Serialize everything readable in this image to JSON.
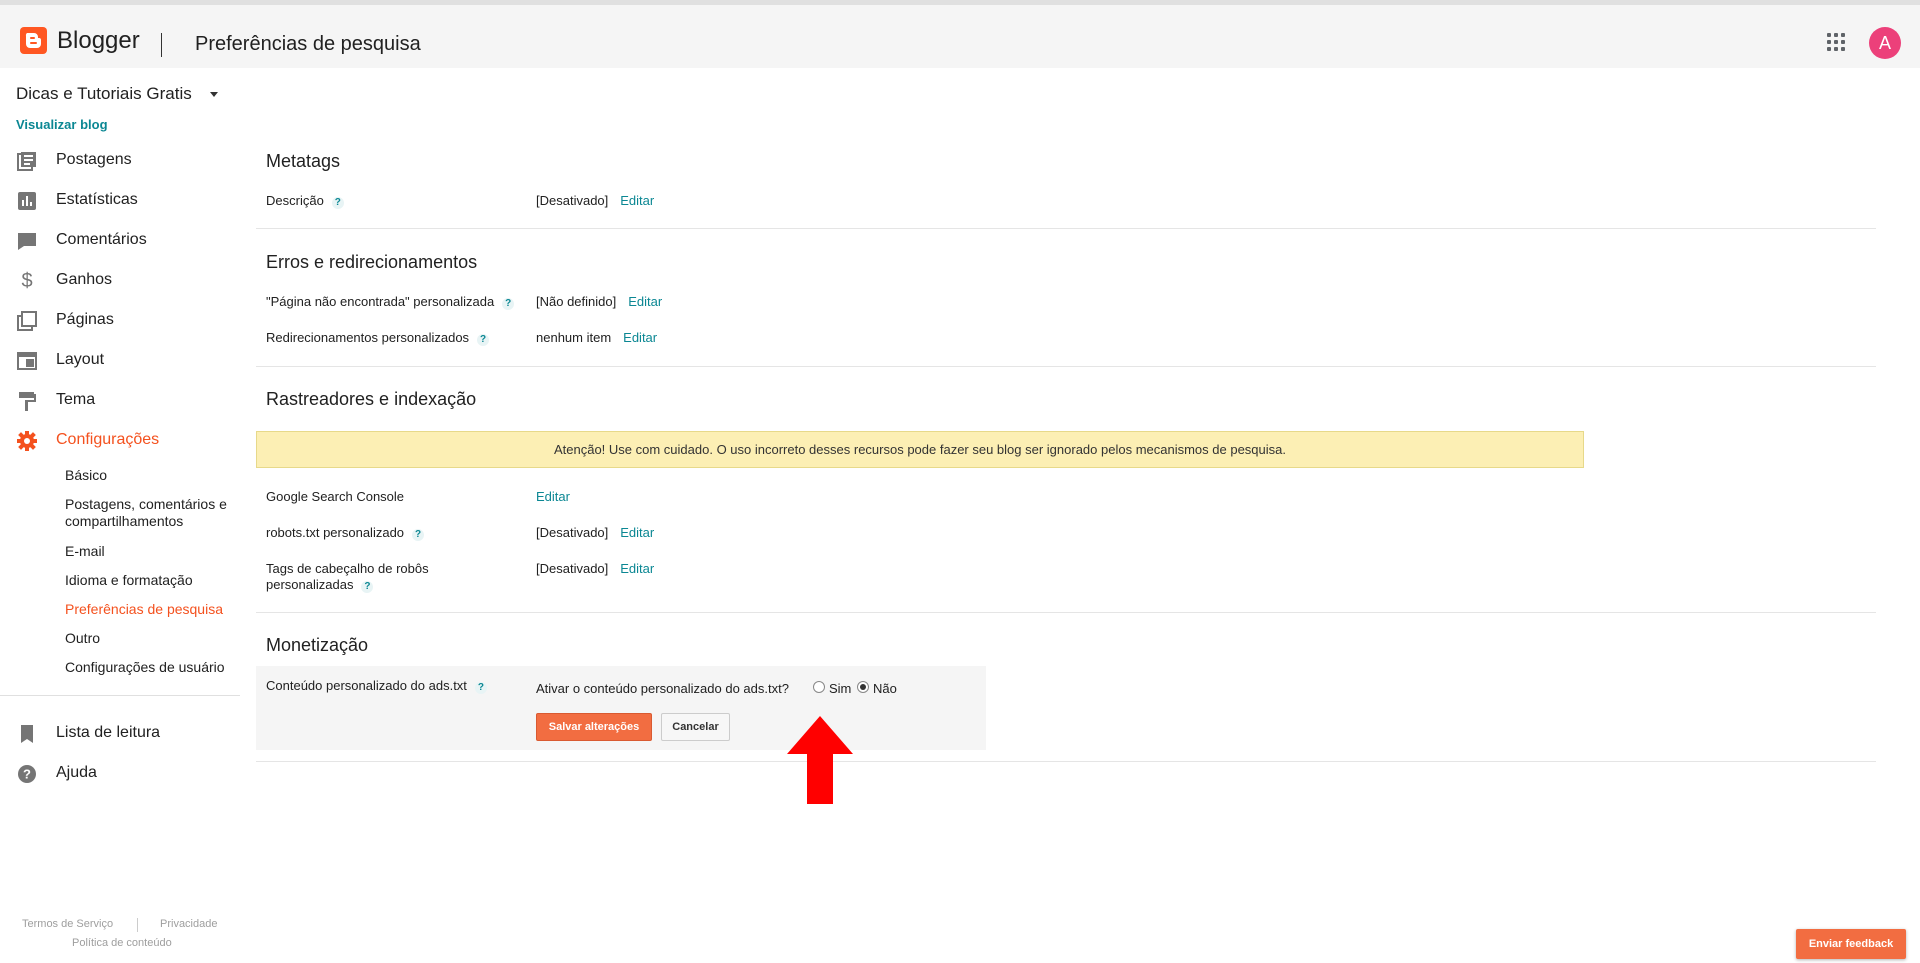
{
  "header": {
    "brand": "Blogger",
    "page_title": "Preferências de pesquisa",
    "avatar_letter": "A"
  },
  "sidebar": {
    "blog_name": "Dicas e Tutoriais Gratis",
    "view_blog": "Visualizar blog",
    "items": [
      {
        "label": "Postagens",
        "icon": "posts-icon"
      },
      {
        "label": "Estatísticas",
        "icon": "stats-icon"
      },
      {
        "label": "Comentários",
        "icon": "comments-icon"
      },
      {
        "label": "Ganhos",
        "icon": "dollar-icon"
      },
      {
        "label": "Páginas",
        "icon": "pages-icon"
      },
      {
        "label": "Layout",
        "icon": "layout-icon"
      },
      {
        "label": "Tema",
        "icon": "theme-icon"
      },
      {
        "label": "Configurações",
        "icon": "gear-icon"
      }
    ],
    "subitems": [
      "Básico",
      "Postagens, comentários e compartilhamentos",
      "E-mail",
      "Idioma e formatação",
      "Preferências de pesquisa",
      "Outro",
      "Configurações de usuário"
    ],
    "reading_list": "Lista de leitura",
    "help": "Ajuda",
    "footer": {
      "terms": "Termos de Serviço",
      "privacy": "Privacidade",
      "content_policy": "Política de conteúdo"
    }
  },
  "main": {
    "metatags": {
      "title": "Metatags",
      "description_label": "Descrição",
      "description_value": "[Desativado]",
      "edit": "Editar"
    },
    "errors": {
      "title": "Erros e redirecionamentos",
      "not_found_label": "\"Página não encontrada\" personalizada",
      "not_found_value": "[Não definido]",
      "redirects_label": "Redirecionamentos personalizados",
      "redirects_value": "nenhum item",
      "edit": "Editar"
    },
    "crawlers": {
      "title": "Rastreadores e indexação",
      "warning": "Atenção! Use com cuidado. O uso incorreto desses recursos pode fazer seu blog ser ignorado pelos mecanismos de pesquisa.",
      "search_console_label": "Google Search Console",
      "robots_label": "robots.txt personalizado",
      "robots_value": "[Desativado]",
      "robots_tags_label_1": "Tags de cabeçalho de robôs",
      "robots_tags_label_2": "personalizadas",
      "robots_tags_value": "[Desativado]",
      "edit": "Editar"
    },
    "monetization": {
      "title": "Monetização",
      "ads_label": "Conteúdo personalizado do ads.txt",
      "question": "Ativar o conteúdo personalizado do ads.txt?",
      "yes": "Sim",
      "no": "Não",
      "selected": "Não",
      "save": "Salvar alterações",
      "cancel": "Cancelar"
    }
  },
  "feedback_button": "Enviar feedback",
  "colors": {
    "accent": "#f4511e",
    "link": "#0b8793",
    "warning_bg": "#fcefb4"
  }
}
